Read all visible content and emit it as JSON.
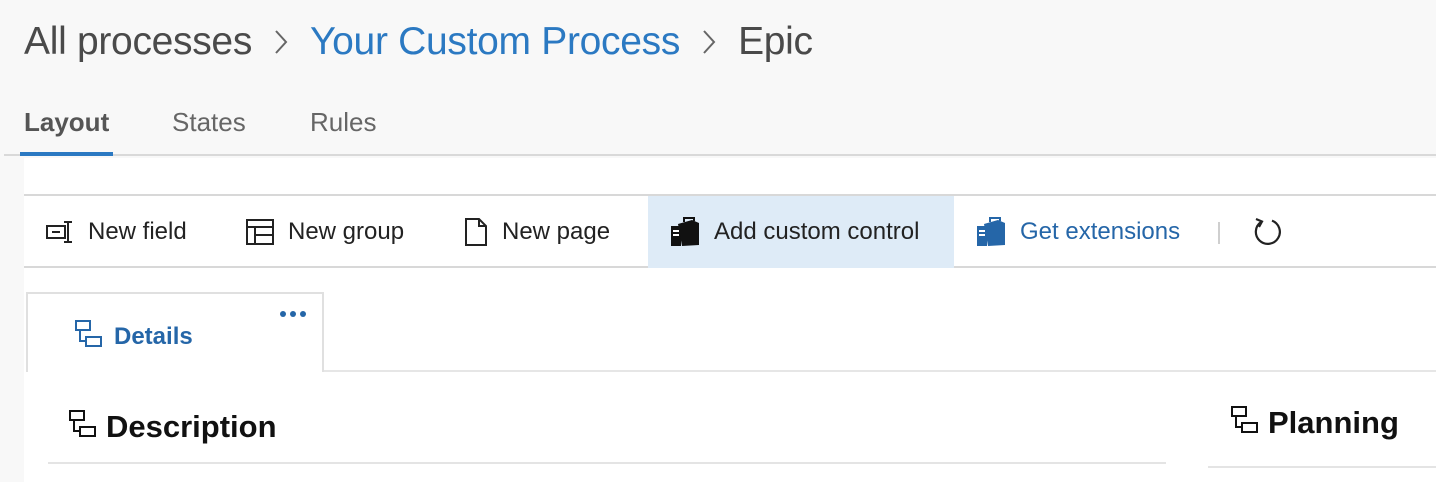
{
  "breadcrumb": {
    "items": [
      "All processes",
      "Your Custom Process",
      "Epic"
    ]
  },
  "tabs": [
    {
      "label": "Layout",
      "active": true
    },
    {
      "label": "States",
      "active": false
    },
    {
      "label": "Rules",
      "active": false
    }
  ],
  "toolbar": {
    "new_field": "New field",
    "new_group": "New group",
    "new_page": "New page",
    "add_custom_control": "Add custom control",
    "get_extensions": "Get extensions"
  },
  "page_tab": {
    "label": "Details"
  },
  "groups": {
    "description": "Description",
    "planning": "Planning"
  },
  "colors": {
    "accent": "#2b79c2",
    "link": "#2566a8",
    "highlight": "#deebf7"
  }
}
